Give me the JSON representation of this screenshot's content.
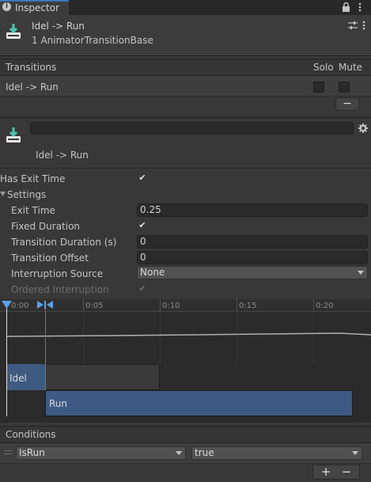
{
  "tab": {
    "icon": "info-icon",
    "label": "Inspector"
  },
  "tab_icons": {
    "lock": "lock-icon",
    "menu": "kebab-menu-icon"
  },
  "header": {
    "icon": "animator-transition-icon",
    "title": "Idel -> Run",
    "subtitle": "1 AnimatorTransitionBase",
    "settings_icon": "sliders-icon",
    "menu_icon": "kebab-menu-icon"
  },
  "transitions": {
    "header": "Transitions",
    "solo_label": "Solo",
    "mute_label": "Mute",
    "rows": [
      {
        "name": "Idel -> Run",
        "solo": false,
        "mute": false
      }
    ],
    "remove_label": "−"
  },
  "transition": {
    "icon": "animator-transition-icon",
    "name_value": "",
    "gear_icon": "gear-icon",
    "label": "Idel -> Run"
  },
  "props": {
    "has_exit_time": {
      "label": "Has Exit Time",
      "checked": true
    },
    "settings": {
      "label": "Settings",
      "icon": "foldout-arrow-icon"
    },
    "exit_time": {
      "label": "Exit Time",
      "value": "0.25"
    },
    "fixed_duration": {
      "label": "Fixed Duration",
      "checked": true
    },
    "transition_duration": {
      "label": "Transition Duration (s)",
      "value": "0"
    },
    "transition_offset": {
      "label": "Transition Offset",
      "value": "0"
    },
    "interruption_source": {
      "label": "Interruption Source",
      "value": "None"
    },
    "ordered_interruption": {
      "label": "Ordered Interruption",
      "checked": true
    }
  },
  "timeline": {
    "tick_labels": [
      "0:00",
      "0:05",
      "0:10",
      "0:15",
      "0:20"
    ],
    "clips": {
      "source": "Idel",
      "destination": "Run"
    },
    "colors": {
      "source": "#3e5a80",
      "destination": "#3d5a85",
      "cursor": "#5ca0e8"
    }
  },
  "conditions": {
    "header": "Conditions",
    "rows": [
      {
        "parameter": "IsRun",
        "value": "true"
      }
    ],
    "add_label": "+",
    "remove_label": "−"
  }
}
